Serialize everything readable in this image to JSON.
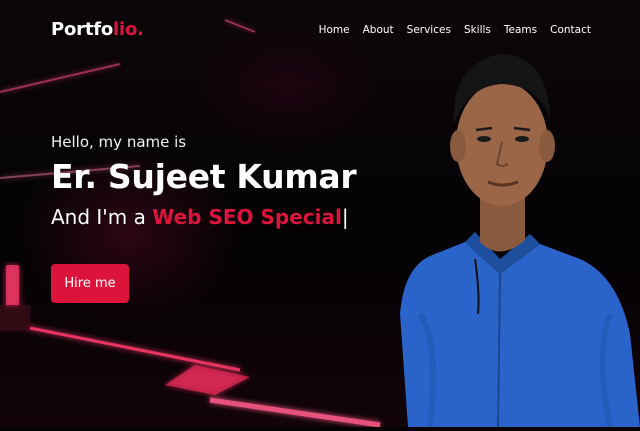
{
  "brand": {
    "logo_main": "Portfo",
    "logo_accent": "lio."
  },
  "nav": {
    "items": [
      {
        "label": "Home"
      },
      {
        "label": "About"
      },
      {
        "label": "Services"
      },
      {
        "label": "Skills"
      },
      {
        "label": "Teams"
      },
      {
        "label": "Contact"
      }
    ]
  },
  "hero": {
    "greeting": "Hello, my name is",
    "name": "Er. Sujeet Kumar",
    "role_prefix": "And I'm a",
    "role_typed": "Web SEO Special",
    "cursor": "|",
    "cta_label": "Hire me"
  },
  "colors": {
    "accent": "#dc143c",
    "background": "#050205",
    "shirt": "#2a63c9"
  },
  "icons": {
    "photo": "profile-photo",
    "background": "neon-light-streaks"
  }
}
